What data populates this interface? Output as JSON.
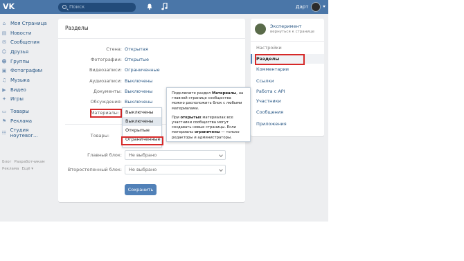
{
  "header": {
    "logo": "VK",
    "search_placeholder": "Поиск",
    "user_name": "Дарт"
  },
  "left_nav": {
    "items": [
      {
        "icon": "home-icon",
        "glyph": "⌂",
        "label": "Моя Страница"
      },
      {
        "icon": "news-icon",
        "glyph": "▤",
        "label": "Новости"
      },
      {
        "icon": "message-icon",
        "glyph": "✉",
        "label": "Сообщения"
      },
      {
        "icon": "friends-icon",
        "glyph": "☺",
        "label": "Друзья"
      },
      {
        "icon": "groups-icon",
        "glyph": "☻",
        "label": "Группы"
      },
      {
        "icon": "photo-icon",
        "glyph": "▣",
        "label": "Фотографии"
      },
      {
        "icon": "music-icon",
        "glyph": "♫",
        "label": "Музыка"
      },
      {
        "icon": "video-icon",
        "glyph": "▶",
        "label": "Видео"
      },
      {
        "icon": "games-icon",
        "glyph": "✦",
        "label": "Игры"
      }
    ],
    "items2": [
      {
        "icon": "goods-icon",
        "glyph": "▭",
        "label": "Товары"
      },
      {
        "icon": "ads-icon",
        "glyph": "⚑",
        "label": "Реклама"
      }
    ],
    "items3": [
      {
        "icon": "community-icon",
        "glyph": "☷",
        "label": "Студия ноутевог..."
      }
    ],
    "footer": {
      "blog": "Блог",
      "developers": "Разработчикам",
      "ads": "Реклама",
      "more": "Ещё ▾"
    }
  },
  "main": {
    "title": "Разделы",
    "rows": [
      {
        "label": "Стена:",
        "value": "Открытая"
      },
      {
        "label": "Фотографии:",
        "value": "Открытые"
      },
      {
        "label": "Видеозаписи:",
        "value": "Ограниченные"
      },
      {
        "label": "Аудиозаписи:",
        "value": "Выключены"
      },
      {
        "label": "Документы:",
        "value": "Выключены"
      },
      {
        "label": "Обсуждения:",
        "value": "Выключены"
      },
      {
        "label": "Материалы:",
        "value": "Выключены"
      }
    ],
    "goods_label": "Товары:",
    "dropdown": [
      "Выключены",
      "Выключены",
      "Открытые",
      "Ограниченные"
    ],
    "main_block_label": "Главный блок:",
    "main_block_value": "Не выбрано",
    "secondary_block_label": "Второстепенный блок:",
    "secondary_block_value": "Не выбрано",
    "save": "Сохранить"
  },
  "right_panel": {
    "community_name": "Эксперимент",
    "back_link": "вернуться к странице",
    "items": [
      "Настройки",
      "Разделы",
      "Комментарии",
      "Ссылки",
      "Работа с API",
      "Участники",
      "Сообщения",
      "Приложения"
    ],
    "partial_items": [
      "та с API",
      "ки",
      "щения",
      "ожения"
    ]
  },
  "tooltip": {
    "p1_pre": "Подключите раздел ",
    "p1_bold": "Материалы",
    "p1_post": ", на главной странице сообщества можно расположить блок с любыми материалами.",
    "p2_pre": "При ",
    "p2_bold1": "открытых",
    "p2_mid": " материалах все участники сообщества могут создавать новые страницы. Если материалы ",
    "p2_bold2": "ограничены",
    "p2_post": " — только редакторы и администраторы."
  },
  "colors": {
    "header_bg": "#4a76a8",
    "link": "#2a5885",
    "highlight_red": "#d62828",
    "button": "#5181b8"
  }
}
